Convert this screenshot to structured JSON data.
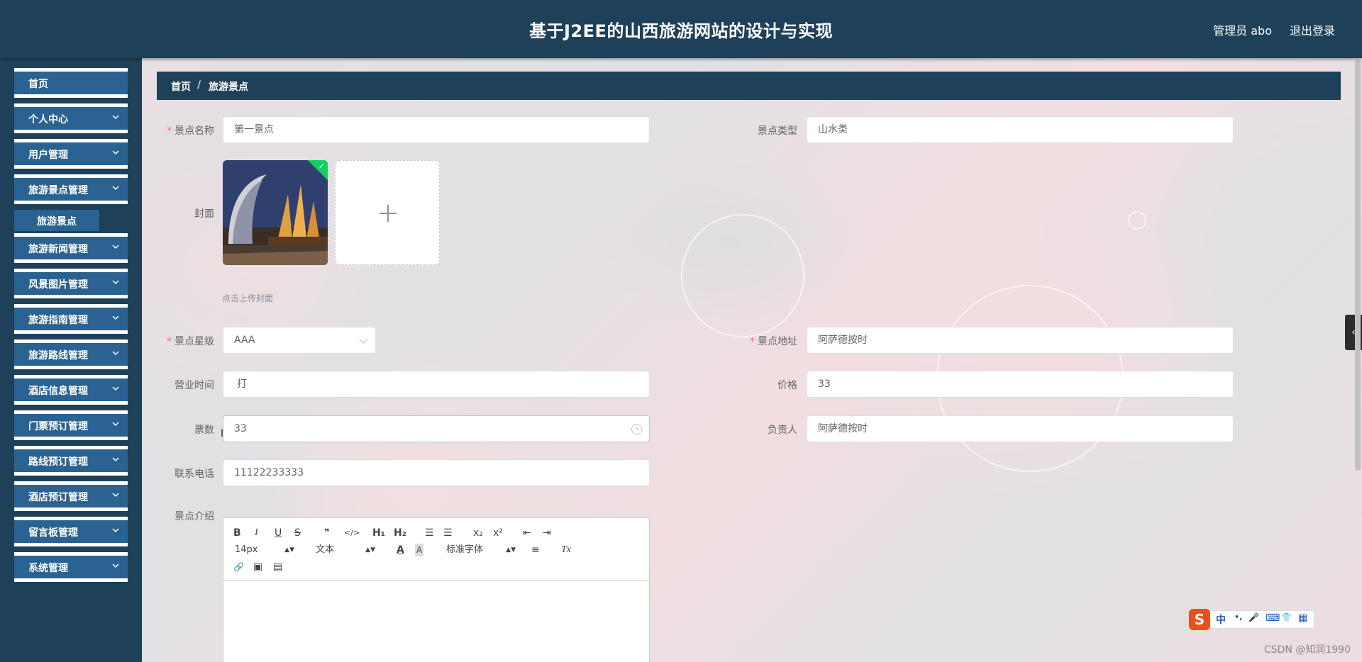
{
  "header": {
    "title": "基于J2EE的山西旅游网站的设计与实现",
    "user": "管理员 abo",
    "logout": "退出登录"
  },
  "sidebar": {
    "items": [
      {
        "label": "首页",
        "has_chevron": false
      },
      {
        "label": "个人中心",
        "has_chevron": true
      },
      {
        "label": "用户管理",
        "has_chevron": true
      },
      {
        "label": "旅游景点管理",
        "has_chevron": true
      },
      {
        "label": "旅游新闻管理",
        "has_chevron": true
      },
      {
        "label": "风景图片管理",
        "has_chevron": true
      },
      {
        "label": "旅游指南管理",
        "has_chevron": true
      },
      {
        "label": "旅游路线管理",
        "has_chevron": true
      },
      {
        "label": "酒店信息管理",
        "has_chevron": true
      },
      {
        "label": "门票预订管理",
        "has_chevron": true
      },
      {
        "label": "路线预订管理",
        "has_chevron": true
      },
      {
        "label": "酒店预订管理",
        "has_chevron": true
      },
      {
        "label": "留言板管理",
        "has_chevron": true
      },
      {
        "label": "系统管理",
        "has_chevron": true
      }
    ],
    "subitem": "旅游景点",
    "chevron_icon": "chevron-down-icon"
  },
  "breadcrumb": {
    "home": "首页",
    "separator": "/",
    "current": "旅游景点"
  },
  "form": {
    "name": {
      "label": "景点名称",
      "value": "第一景点",
      "required": true
    },
    "type": {
      "label": "景点类型",
      "value": "山水类",
      "required": false
    },
    "cover": {
      "label": "封面",
      "hint": "点击上传封面"
    },
    "rating": {
      "label": "景点星级",
      "value": "AAA",
      "required": true
    },
    "address": {
      "label": "景点地址",
      "value": "阿萨德按时",
      "required": true
    },
    "hours": {
      "label": "营业时间",
      "value": "打"
    },
    "price": {
      "label": "价格",
      "value": "33"
    },
    "tickets": {
      "label": "票数",
      "value": "33"
    },
    "manager": {
      "label": "负责人",
      "value": "阿萨德按时"
    },
    "phone": {
      "label": "联系电话",
      "value": "11122233333"
    },
    "intro": {
      "label": "景点介绍"
    }
  },
  "editor": {
    "bold": "B",
    "italic": "I",
    "underline": "U",
    "strike": "S",
    "quote": "❞",
    "code": "</>",
    "h1": "H₁",
    "h2": "H₂",
    "ol": "☰",
    "ul": "☰",
    "sub": "x₂",
    "sup": "x²",
    "outdent": "⇤",
    "indent": "⇥",
    "size": "14px",
    "format": "文本",
    "color": "A",
    "bg": "A",
    "font": "标准字体",
    "align": "≡",
    "clear": "Tx",
    "link": "🔗",
    "image": "▣",
    "video": "▤"
  },
  "ime": {
    "logo": "S",
    "lang": "中",
    "punct": "•,",
    "mic": "🎤",
    "kbd": "⌨",
    "skin": "👕",
    "tools": "▦"
  },
  "watermark": "CSDN @知润1990",
  "side_tab": "‹"
}
